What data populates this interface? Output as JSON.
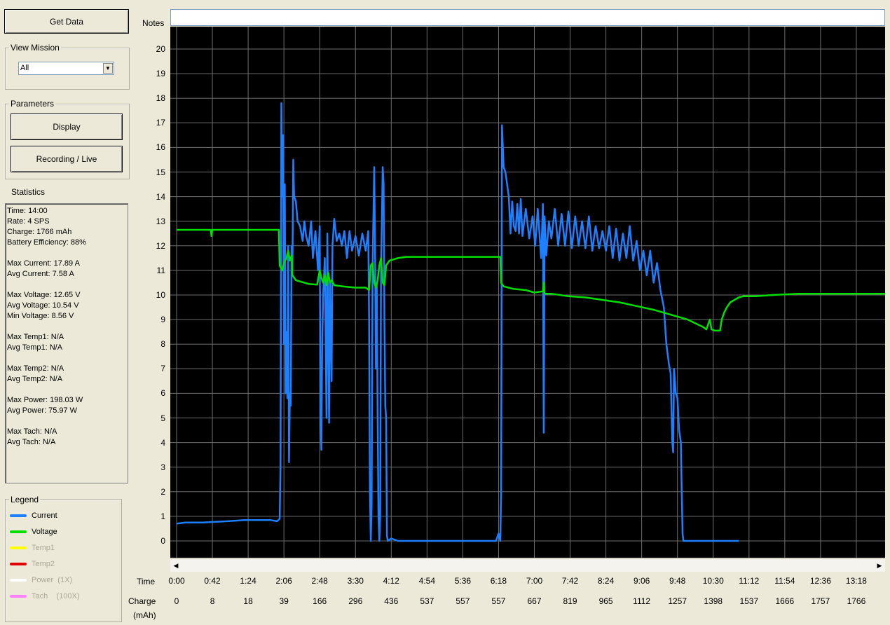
{
  "toolbar": {
    "get_data_label": "Get Data"
  },
  "view_mission": {
    "title": "View Mission",
    "selected": "All"
  },
  "parameters": {
    "title": "Parameters",
    "display_label": "Display",
    "recording_label": "Recording / Live"
  },
  "statistics": {
    "title": "Statistics",
    "lines": [
      [
        "Time: 14:00",
        "Rate: 4 SPS",
        "Charge: 1766 mAh",
        "Battery Efficiency: 88%"
      ],
      [
        "Max Current: 17.89 A",
        "Avg Current: 7.58 A"
      ],
      [
        "Max Voltage: 12.65 V",
        "Avg Voltage: 10.54 V",
        "Min Voltage: 8.56 V"
      ],
      [
        "Max Temp1: N/A",
        "Avg Temp1: N/A"
      ],
      [
        "Max Temp2: N/A",
        "Avg Temp2: N/A"
      ],
      [
        "Max Power: 198.03 W",
        "Avg Power: 75.97 W"
      ],
      [
        "Max Tach: N/A",
        "Avg Tach: N/A"
      ]
    ]
  },
  "legend": {
    "title": "Legend",
    "items": [
      {
        "label": "Current",
        "color": "#1e7fff",
        "active": true
      },
      {
        "label": "Voltage",
        "color": "#00e000",
        "active": true
      },
      {
        "label": "Temp1",
        "color": "#ffff00",
        "active": false
      },
      {
        "label": "Temp2",
        "color": "#e00000",
        "active": false
      },
      {
        "label": "Power  (1X)",
        "color": "#ffffff",
        "active": false
      },
      {
        "label": "Tach    (100X)",
        "color": "#ff80ff",
        "active": false
      }
    ]
  },
  "notes": {
    "label": "Notes",
    "value": ""
  },
  "axis_labels": {
    "time": "Time",
    "charge": "Charge",
    "charge_unit": "(mAh)"
  },
  "chart_data": {
    "type": "line",
    "ylim": [
      0,
      20
    ],
    "y_ticks": [
      "0",
      "1",
      "2",
      "3",
      "4",
      "5",
      "6",
      "7",
      "8",
      "9",
      "10",
      "11",
      "12",
      "13",
      "14",
      "15",
      "16",
      "17",
      "18",
      "19",
      "20"
    ],
    "time_ticks": [
      "0:00",
      "0:42",
      "1:24",
      "2:06",
      "2:48",
      "3:30",
      "4:12",
      "4:54",
      "5:36",
      "6:18",
      "7:00",
      "7:42",
      "8:24",
      "9:06",
      "9:48",
      "10:30",
      "11:12",
      "11:54",
      "12:36",
      "13:18"
    ],
    "charge_ticks": [
      "0",
      "8",
      "18",
      "39",
      "166",
      "296",
      "436",
      "537",
      "557",
      "557",
      "667",
      "819",
      "965",
      "1112",
      "1257",
      "1398",
      "1537",
      "1666",
      "1757",
      "1766"
    ],
    "x_unit_seconds_max": 840,
    "grid": true,
    "series": [
      {
        "name": "Current",
        "color": "#1e7fff",
        "points": [
          [
            0,
            0.7
          ],
          [
            10,
            0.75
          ],
          [
            30,
            0.75
          ],
          [
            60,
            0.8
          ],
          [
            80,
            0.85
          ],
          [
            110,
            0.85
          ],
          [
            118,
            0.8
          ],
          [
            121,
            0.9
          ],
          [
            122,
            3
          ],
          [
            123,
            17.8
          ],
          [
            124,
            14
          ],
          [
            125,
            16.5
          ],
          [
            126,
            8
          ],
          [
            127,
            14.5
          ],
          [
            128,
            6
          ],
          [
            129,
            8.5
          ],
          [
            130,
            5.8
          ],
          [
            131,
            12
          ],
          [
            132,
            3.2
          ],
          [
            133,
            6
          ],
          [
            134,
            5.5
          ],
          [
            135,
            12
          ],
          [
            136,
            11
          ],
          [
            137,
            15.5
          ],
          [
            138,
            14
          ],
          [
            140,
            13.8
          ],
          [
            142,
            13
          ],
          [
            145,
            12.8
          ],
          [
            148,
            12.2
          ],
          [
            150,
            13
          ],
          [
            152,
            12.4
          ],
          [
            155,
            12
          ],
          [
            158,
            13
          ],
          [
            160,
            11.5
          ],
          [
            163,
            12.6
          ],
          [
            166,
            11
          ],
          [
            168,
            12.8
          ],
          [
            169,
            5
          ],
          [
            170,
            3.7
          ],
          [
            171,
            8
          ],
          [
            172,
            10
          ],
          [
            174,
            11.5
          ],
          [
            176,
            5
          ],
          [
            177,
            12.5
          ],
          [
            179,
            4.8
          ],
          [
            180,
            10.5
          ],
          [
            182,
            6.5
          ],
          [
            183,
            12
          ],
          [
            185,
            13.1
          ],
          [
            188,
            12.2
          ],
          [
            191,
            12.5
          ],
          [
            194,
            12
          ],
          [
            197,
            12.6
          ],
          [
            200,
            11.5
          ],
          [
            203,
            12.6
          ],
          [
            206,
            11.8
          ],
          [
            210,
            12.4
          ],
          [
            214,
            11.6
          ],
          [
            218,
            12.5
          ],
          [
            222,
            11.8
          ],
          [
            225,
            12.6
          ],
          [
            226,
            9
          ],
          [
            227,
            2
          ],
          [
            228,
            0
          ],
          [
            229,
            1.5
          ],
          [
            230,
            11
          ],
          [
            232,
            15.2
          ],
          [
            233,
            12
          ],
          [
            234,
            7
          ],
          [
            235,
            10.5
          ],
          [
            236,
            5
          ],
          [
            237,
            1
          ],
          [
            238,
            0
          ],
          [
            239,
            1
          ],
          [
            240,
            11
          ],
          [
            241,
            13
          ],
          [
            242,
            15.2
          ],
          [
            243,
            14.5
          ],
          [
            244,
            9
          ],
          [
            245,
            5.5
          ],
          [
            246,
            5
          ],
          [
            247,
            0.2
          ],
          [
            248,
            0
          ],
          [
            252,
            0.1
          ],
          [
            260,
            0
          ],
          [
            280,
            0
          ],
          [
            300,
            0
          ],
          [
            360,
            0
          ],
          [
            375,
            0
          ],
          [
            378,
            0.3
          ],
          [
            380,
            0
          ],
          [
            381,
            2
          ],
          [
            382,
            16.9
          ],
          [
            384,
            15.2
          ],
          [
            386,
            15
          ],
          [
            388,
            14.5
          ],
          [
            390,
            14
          ],
          [
            392,
            12.5
          ],
          [
            394,
            13.8
          ],
          [
            396,
            12.8
          ],
          [
            398,
            12.6
          ],
          [
            400,
            13.7
          ],
          [
            402,
            12.5
          ],
          [
            404,
            13.9
          ],
          [
            406,
            12.4
          ],
          [
            410,
            13.5
          ],
          [
            414,
            12.3
          ],
          [
            418,
            13.2
          ],
          [
            421,
            12
          ],
          [
            424,
            13.5
          ],
          [
            428,
            11.5
          ],
          [
            430,
            13.7
          ],
          [
            431,
            4.4
          ],
          [
            432,
            13.2
          ],
          [
            434,
            11.6
          ],
          [
            437,
            13
          ],
          [
            440,
            12.3
          ],
          [
            444,
            13.5
          ],
          [
            448,
            12
          ],
          [
            452,
            13.3
          ],
          [
            456,
            12
          ],
          [
            460,
            13.4
          ],
          [
            464,
            11.9
          ],
          [
            468,
            13.2
          ],
          [
            472,
            12
          ],
          [
            476,
            13
          ],
          [
            480,
            11.9
          ],
          [
            484,
            13.2
          ],
          [
            488,
            11.8
          ],
          [
            492,
            12.8
          ],
          [
            496,
            11.9
          ],
          [
            500,
            12.6
          ],
          [
            504,
            11.8
          ],
          [
            508,
            12.8
          ],
          [
            512,
            11.5
          ],
          [
            516,
            12.7
          ],
          [
            520,
            11.4
          ],
          [
            524,
            12.5
          ],
          [
            528,
            11.5
          ],
          [
            532,
            12.8
          ],
          [
            536,
            11.4
          ],
          [
            540,
            12.2
          ],
          [
            544,
            11
          ],
          [
            548,
            11.8
          ],
          [
            552,
            10.8
          ],
          [
            556,
            11.8
          ],
          [
            560,
            10.5
          ],
          [
            564,
            11.3
          ],
          [
            568,
            10.2
          ],
          [
            572,
            9.5
          ],
          [
            575,
            8
          ],
          [
            578,
            7.2
          ],
          [
            580,
            6.8
          ],
          [
            582,
            4
          ],
          [
            583,
            3.6
          ],
          [
            584,
            7
          ],
          [
            586,
            6
          ],
          [
            588,
            5.8
          ],
          [
            590,
            4.5
          ],
          [
            592,
            4
          ],
          [
            593,
            2
          ],
          [
            594,
            0.3
          ],
          [
            595,
            0
          ],
          [
            600,
            0
          ],
          [
            640,
            0
          ],
          [
            660,
            0
          ]
        ]
      },
      {
        "name": "Voltage",
        "color": "#00e000",
        "points": [
          [
            0,
            12.65
          ],
          [
            40,
            12.65
          ],
          [
            41,
            12.4
          ],
          [
            42,
            12.65
          ],
          [
            120,
            12.65
          ],
          [
            121,
            11.2
          ],
          [
            124,
            11
          ],
          [
            126,
            11.3
          ],
          [
            129,
            11.5
          ],
          [
            131,
            11.8
          ],
          [
            133,
            11.4
          ],
          [
            135,
            11.6
          ],
          [
            136,
            10.8
          ],
          [
            140,
            10.6
          ],
          [
            145,
            10.55
          ],
          [
            155,
            10.45
          ],
          [
            165,
            10.42
          ],
          [
            168,
            11
          ],
          [
            170,
            10.7
          ],
          [
            172,
            10.5
          ],
          [
            174,
            10.8
          ],
          [
            176,
            10.4
          ],
          [
            178,
            10.9
          ],
          [
            180,
            10.5
          ],
          [
            182,
            10.6
          ],
          [
            185,
            10.4
          ],
          [
            195,
            10.35
          ],
          [
            210,
            10.3
          ],
          [
            222,
            10.3
          ],
          [
            226,
            10.2
          ],
          [
            228,
            11.2
          ],
          [
            230,
            11.3
          ],
          [
            232,
            10.5
          ],
          [
            234,
            10.3
          ],
          [
            236,
            10.6
          ],
          [
            238,
            11.2
          ],
          [
            240,
            11.5
          ],
          [
            242,
            10.5
          ],
          [
            244,
            10.4
          ],
          [
            246,
            11.2
          ],
          [
            250,
            11.4
          ],
          [
            260,
            11.5
          ],
          [
            270,
            11.55
          ],
          [
            300,
            11.55
          ],
          [
            330,
            11.55
          ],
          [
            360,
            11.55
          ],
          [
            380,
            11.55
          ],
          [
            381,
            10.5
          ],
          [
            384,
            10.35
          ],
          [
            395,
            10.25
          ],
          [
            410,
            10.2
          ],
          [
            420,
            10.1
          ],
          [
            430,
            10.15
          ],
          [
            431,
            10.5
          ],
          [
            432,
            10.05
          ],
          [
            440,
            10.05
          ],
          [
            460,
            9.95
          ],
          [
            480,
            9.9
          ],
          [
            500,
            9.8
          ],
          [
            520,
            9.7
          ],
          [
            540,
            9.55
          ],
          [
            560,
            9.4
          ],
          [
            580,
            9.2
          ],
          [
            600,
            9
          ],
          [
            618,
            8.7
          ],
          [
            622,
            8.6
          ],
          [
            626,
            9
          ],
          [
            628,
            8.6
          ],
          [
            632,
            8.55
          ],
          [
            638,
            8.55
          ],
          [
            640,
            9
          ],
          [
            643,
            9.3
          ],
          [
            646,
            9.5
          ],
          [
            650,
            9.7
          ],
          [
            655,
            9.8
          ],
          [
            660,
            9.9
          ],
          [
            665,
            9.95
          ],
          [
            680,
            9.95
          ],
          [
            700,
            10
          ],
          [
            730,
            10.05
          ],
          [
            760,
            10.05
          ],
          [
            800,
            10.05
          ],
          [
            840,
            10.05
          ]
        ]
      }
    ]
  }
}
